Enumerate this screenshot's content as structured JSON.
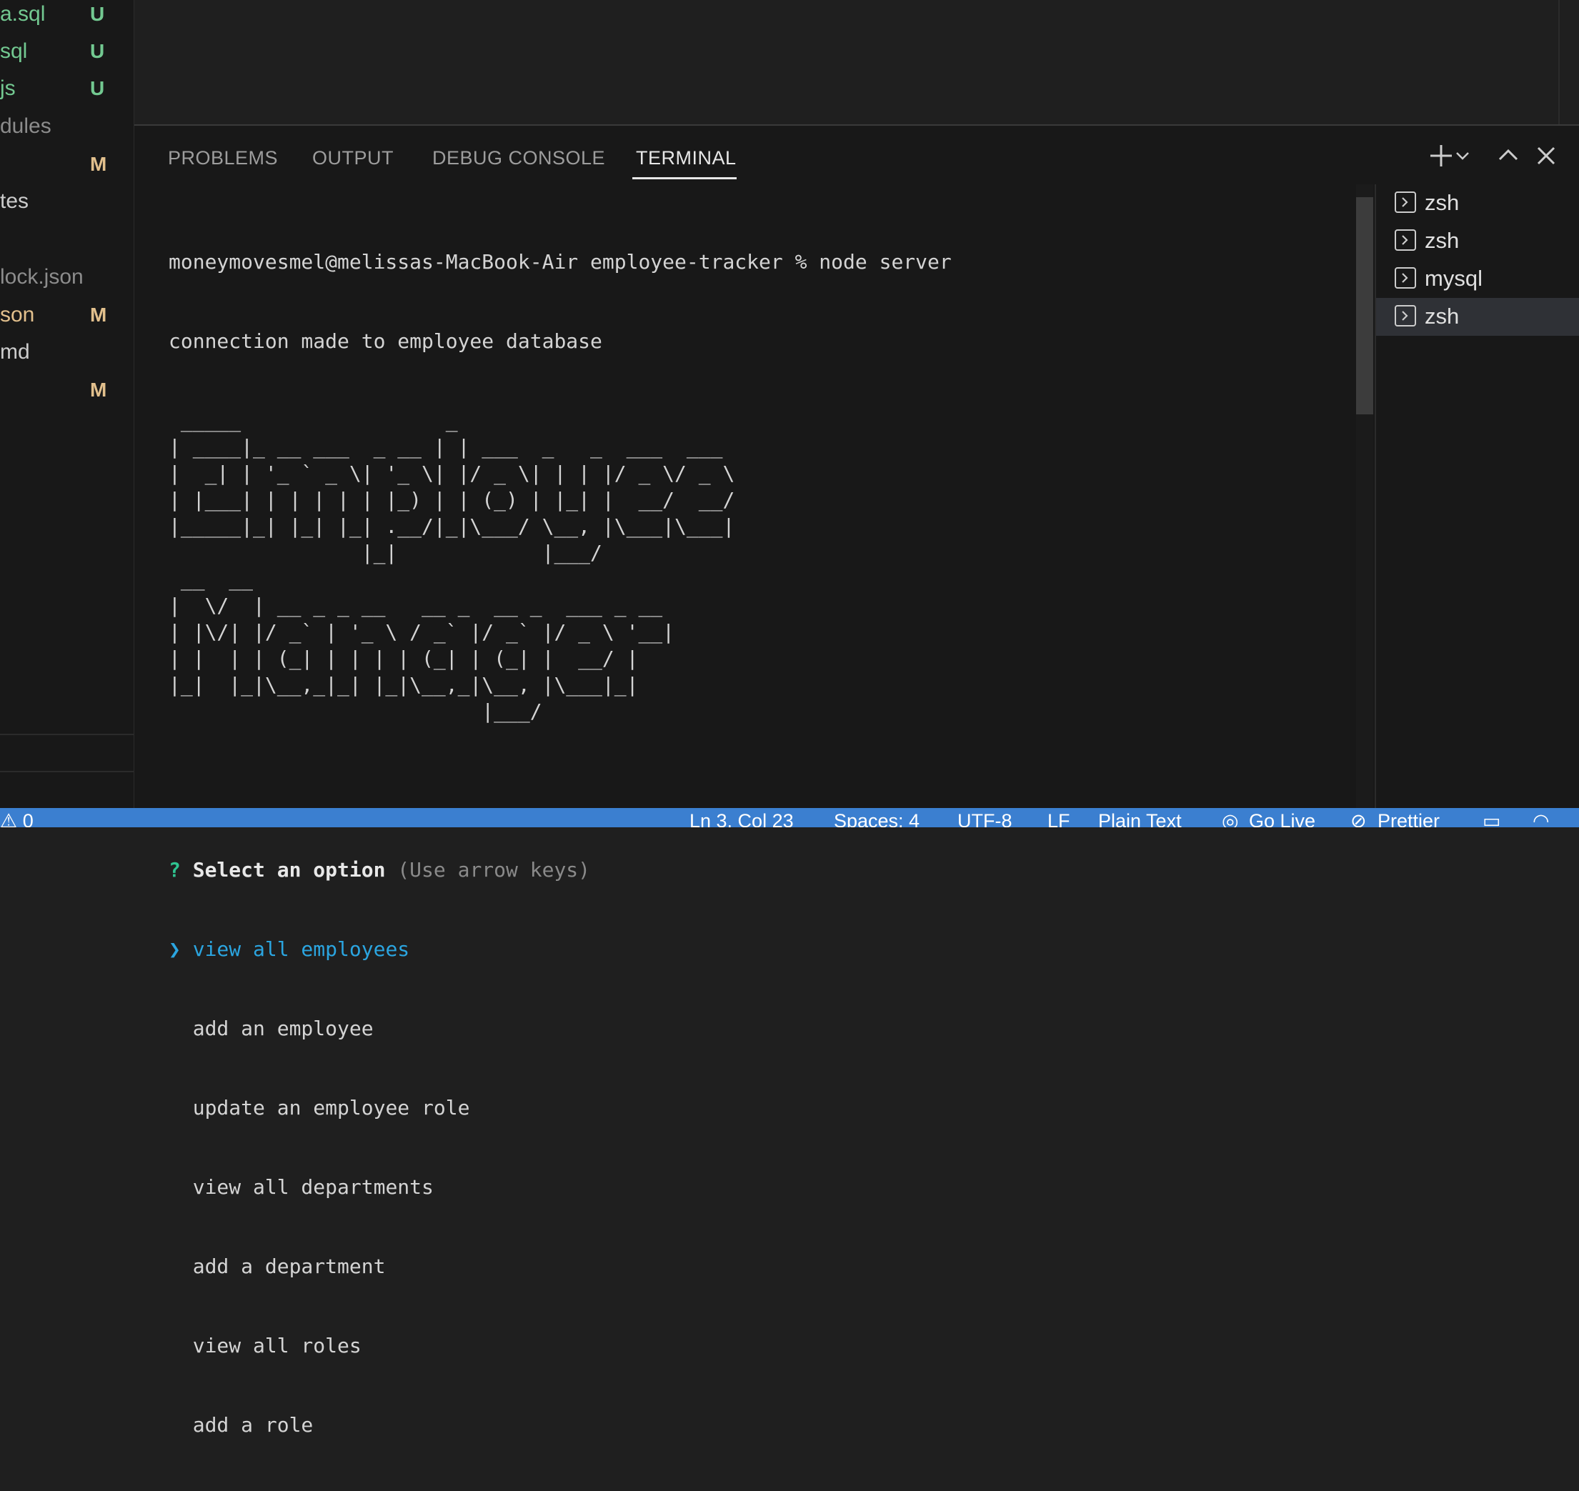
{
  "sidebar": {
    "files": [
      {
        "name": "a.sql",
        "badge": "U",
        "status": "untracked"
      },
      {
        "name": "sql",
        "badge": "U",
        "status": "untracked"
      },
      {
        "name": "js",
        "badge": "U",
        "status": "untracked"
      },
      {
        "name": "dules",
        "badge": "",
        "status": "dim"
      },
      {
        "name": "",
        "badge": "M",
        "status": "modified"
      },
      {
        "name": "tes",
        "badge": "",
        "status": "plain"
      },
      {
        "name": "lock.json",
        "badge": "",
        "status": "dim"
      },
      {
        "name": "son",
        "badge": "M",
        "status": "modified"
      },
      {
        "name": "md",
        "badge": "",
        "status": "plain"
      },
      {
        "name": "",
        "badge": "M",
        "status": "modified"
      }
    ]
  },
  "panel": {
    "tabs": [
      "PROBLEMS",
      "OUTPUT",
      "DEBUG CONSOLE",
      "TERMINAL"
    ],
    "active_tab": "TERMINAL",
    "controls": [
      "plus-icon",
      "chevron-down-icon",
      "chevron-up-icon",
      "close-icon"
    ]
  },
  "terminal": {
    "command_line": "moneymovesmel@melissas-MacBook-Air employee-tracker % node server",
    "output_line": "connection made to employee database",
    "banner": " _____                 _\n| ____|_ __ ___  _ __ | | ___  _   _  ___  ___\n|  _| | '_ ` _ \\| '_ \\| |/ _ \\| | | |/ _ \\/ _ \\\n| |___| | | | | | |_) | | (_) | |_| |  __/  __/\n|_____|_| |_| |_| .__/|_|\\___/ \\__, |\\___|\\___|\n                |_|            |___/\n __  __\n|  \\/  | __ _ _ __   __ _  __ _  ___ _ __\n| |\\/| |/ _` | '_ \\ / _` |/ _` |/ _ \\ '__|\n| |  | | (_| | | | | (_| | (_| |  __/ |\n|_|  |_|\\__,_|_| |_|\\__,_|\\__, |\\___|_|\n                          |___/",
    "prompt": {
      "mark": "?",
      "question": "Select an option",
      "hint": "(Use arrow keys)",
      "pointer": "❯",
      "selected": "view all employees",
      "options": [
        "add an employee",
        "update an employee role",
        "view all departments",
        "add a department",
        "view all roles",
        "add a role"
      ]
    }
  },
  "terminal_list": {
    "items": [
      "zsh",
      "zsh",
      "mysql",
      "zsh"
    ],
    "active_index": 3
  },
  "statusbar": {
    "left": "⚠ 0",
    "position": "Ln 3, Col 23",
    "spaces": "Spaces: 4",
    "encoding": "UTF-8",
    "eol": "LF",
    "language": "Plain Text",
    "go_live": "Go Live",
    "prettier": "Prettier"
  },
  "colors": {
    "untracked": "#73c991",
    "modified": "#e2c08d",
    "statusbar": "#3b7fd0",
    "inquirer_mark": "#2fc390",
    "inquirer_selected": "#2ba5e0"
  }
}
